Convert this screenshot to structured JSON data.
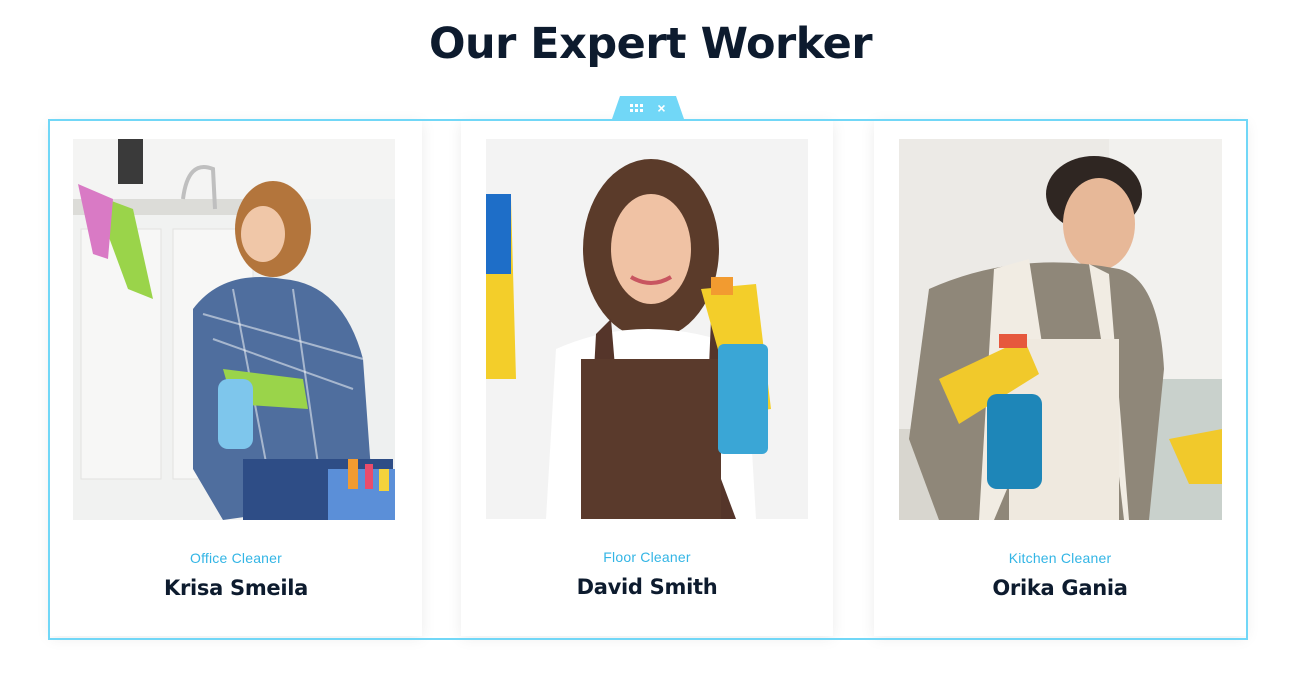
{
  "section": {
    "title": "Our Expert Worker"
  },
  "editor": {
    "drag_icon": "drag-grid-icon",
    "close_glyph": "×",
    "frame_color": "#71d7f7"
  },
  "workers": [
    {
      "role": "Office Cleaner",
      "name": "Krisa Smeila"
    },
    {
      "role": "Floor Cleaner",
      "name": "David Smith"
    },
    {
      "role": "Kitchen Cleaner",
      "name": "Orika Gania"
    }
  ],
  "colors": {
    "accent": "#33b5e5",
    "heading": "#0d1b2e"
  }
}
